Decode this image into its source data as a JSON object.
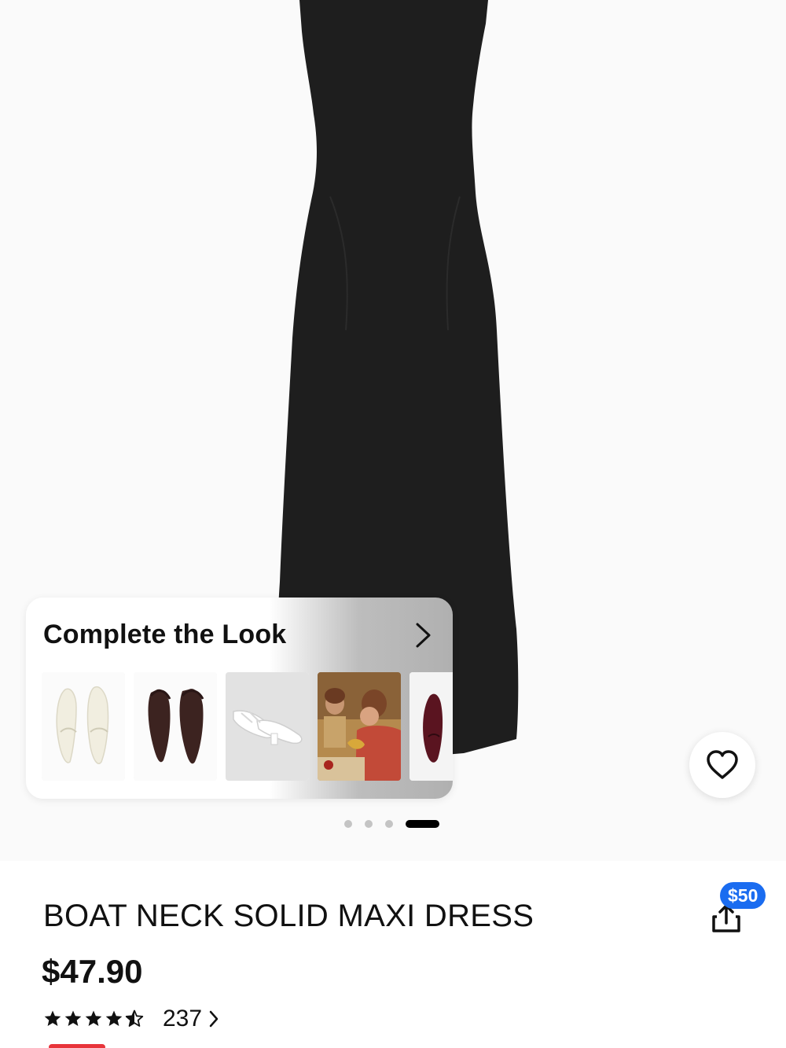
{
  "product_image": {
    "alt": "Black maxi dress",
    "carousel_dots": 4,
    "active_dot": 3
  },
  "complete_the_look": {
    "title": "Complete the Look",
    "thumbnails": [
      {
        "name": "cream-slingback-flats",
        "icon": "shoe-icon"
      },
      {
        "name": "brown-pointed-slingbacks",
        "icon": "shoe-icon"
      },
      {
        "name": "white-strappy-mules",
        "icon": "shoe-icon"
      },
      {
        "name": "lifestyle-photo",
        "icon": "photo-icon"
      },
      {
        "name": "burgundy-ballet-flats",
        "icon": "shoe-icon"
      }
    ]
  },
  "favorite": {
    "icon": "heart-icon"
  },
  "product": {
    "title": "BOAT NECK SOLID MAXI DRESS",
    "price": "$47.90",
    "rating": 4.5,
    "review_count": "237"
  },
  "share": {
    "badge": "$50",
    "icon": "share-icon",
    "badge_color": "#1a6cf0"
  }
}
